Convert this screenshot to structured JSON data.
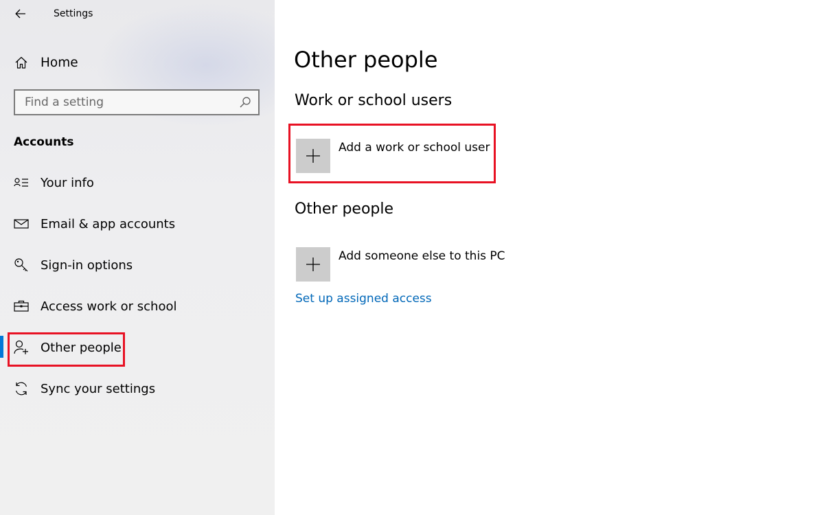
{
  "window": {
    "title": "Settings"
  },
  "sidebar": {
    "home_label": "Home",
    "search": {
      "placeholder": "Find a setting",
      "value": ""
    },
    "section_heading": "Accounts",
    "items": [
      {
        "label": "Your info",
        "icon": "contact-card-icon"
      },
      {
        "label": "Email & app accounts",
        "icon": "mail-icon"
      },
      {
        "label": "Sign-in options",
        "icon": "key-icon"
      },
      {
        "label": "Access work or school",
        "icon": "briefcase-icon"
      },
      {
        "label": "Other people",
        "icon": "add-person-icon",
        "selected": true
      },
      {
        "label": "Sync your settings",
        "icon": "sync-icon"
      }
    ]
  },
  "main": {
    "page_title": "Other people",
    "work_section": {
      "heading": "Work or school users",
      "add_label": "Add a work or school user"
    },
    "other_section": {
      "heading": "Other people",
      "add_label": "Add someone else to this PC"
    },
    "assigned_access_link": "Set up assigned access"
  },
  "colors": {
    "accent": "#0078d7",
    "link": "#0067b8",
    "highlight": "#e81123",
    "add_tile": "#cccccc",
    "sidebar_bg": "#eeeef0"
  }
}
